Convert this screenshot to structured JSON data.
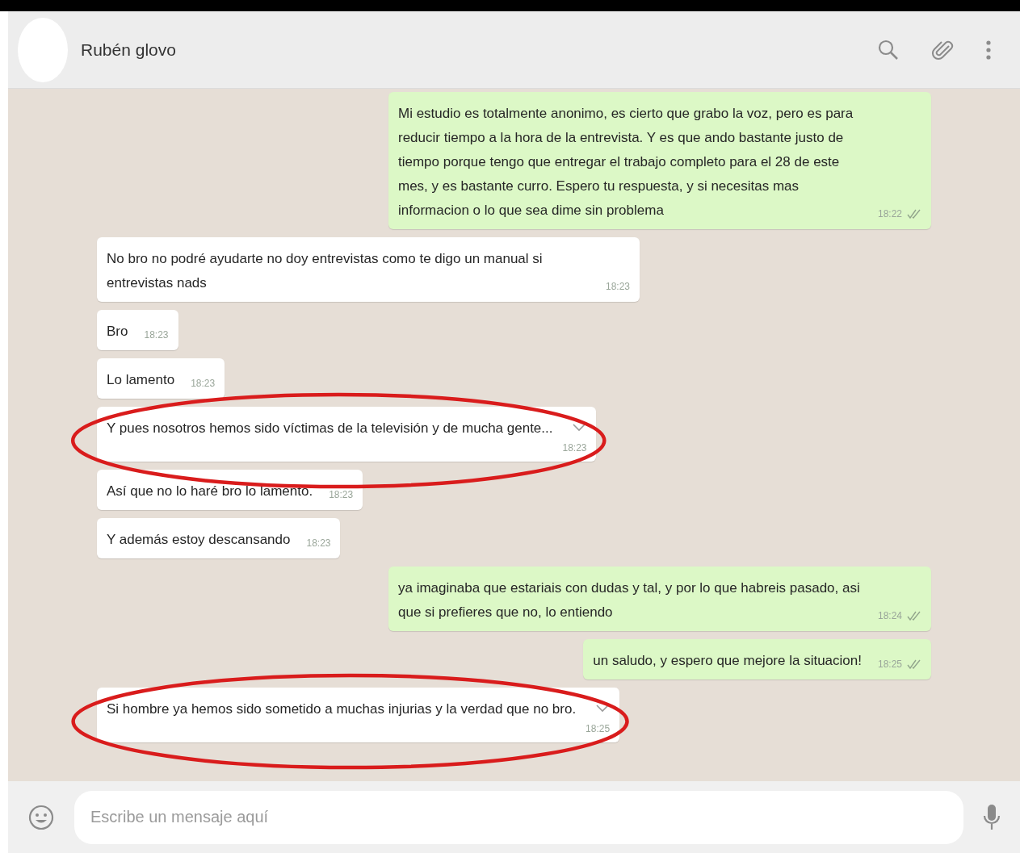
{
  "header": {
    "contact_name": "Rubén glovo"
  },
  "messages": [
    {
      "kind": "outgoing",
      "text": "Mi estudio es totalmente anonimo, es cierto que grabo la voz, pero es para reducir tiempo a la hora de la entrevista. Y es que ando bastante justo de tiempo porque tengo que entregar el trabajo completo para el 28 de este mes, y es bastante curro. Espero tu respuesta, y si necesitas mas informacion o lo que sea dime sin problema",
      "time": "18:22",
      "read": false,
      "hovered": false,
      "highlighted": false
    },
    {
      "kind": "incoming",
      "text": "No bro no podré ayudarte no doy entrevistas como te digo un manual si entrevistas nads",
      "time": "18:23",
      "hovered": false,
      "highlighted": false
    },
    {
      "kind": "incoming",
      "text": "Bro",
      "time": "18:23",
      "hovered": false,
      "highlighted": false
    },
    {
      "kind": "incoming",
      "text": "Lo lamento",
      "time": "18:23",
      "hovered": false,
      "highlighted": false
    },
    {
      "kind": "incoming",
      "text": "Y pues nosotros hemos sido víctimas de la televisión y de mucha gente...",
      "time": "18:23",
      "hovered": true,
      "highlighted": true
    },
    {
      "kind": "incoming",
      "text": "Así que no lo haré bro lo lamento.",
      "time": "18:23",
      "hovered": false,
      "highlighted": false
    },
    {
      "kind": "incoming",
      "text": "Y además estoy descansando",
      "time": "18:23",
      "hovered": false,
      "highlighted": false
    },
    {
      "kind": "outgoing",
      "text": "ya imaginaba que estariais con dudas y tal, y por lo que habreis pasado, asi que si prefieres que no, lo entiendo",
      "time": "18:24",
      "read": false,
      "hovered": false,
      "highlighted": false
    },
    {
      "kind": "outgoing",
      "text": "un saludo, y espero que mejore la situacion!",
      "time": "18:25",
      "read": false,
      "hovered": false,
      "highlighted": false
    },
    {
      "kind": "incoming",
      "text": "Si hombre ya hemos sido sometido a muchas injurias y la verdad que no bro.",
      "time": "18:25",
      "hovered": true,
      "highlighted": true
    }
  ],
  "composer": {
    "placeholder": "Escribe un mensaje aquí"
  }
}
